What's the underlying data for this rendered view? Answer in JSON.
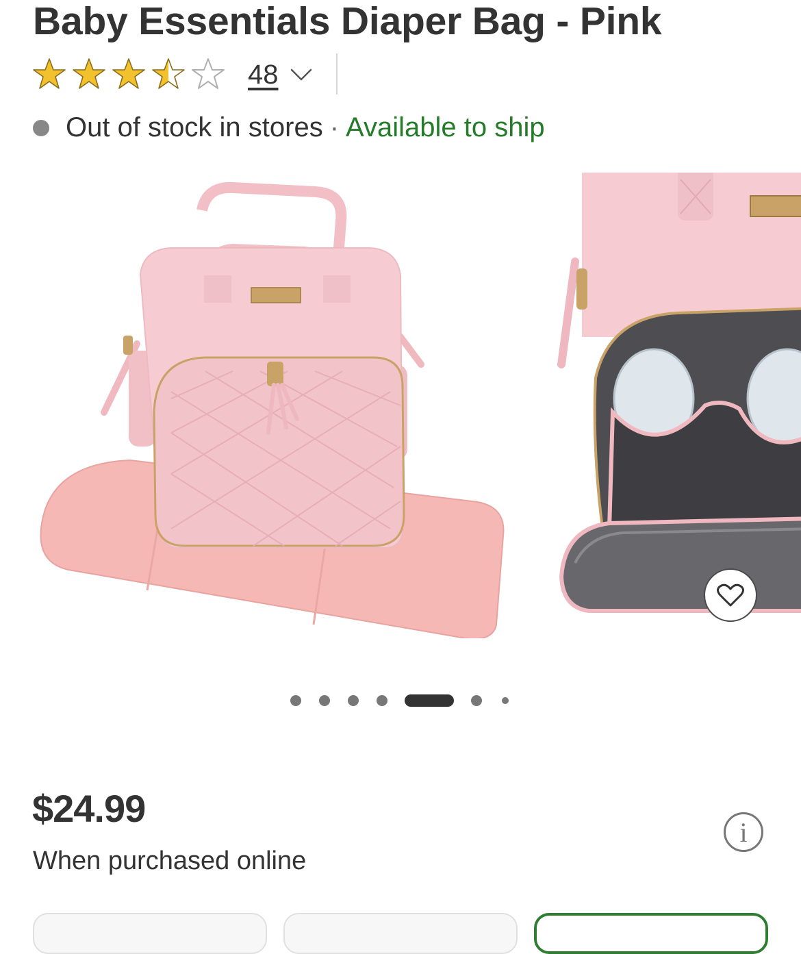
{
  "product": {
    "title": "Baby Essentials Diaper Bag - Pink",
    "rating": 3.5,
    "rating_max": 5,
    "review_count": "48"
  },
  "availability": {
    "in_store": "Out of stock in stores",
    "separator": "·",
    "ship": "Available to ship"
  },
  "gallery": {
    "slide_count": 7,
    "active_index": 4
  },
  "pricing": {
    "price": "$24.99",
    "note": "When purchased online",
    "info_label": "i"
  },
  "colors": {
    "text": "#333333",
    "available_green": "#247c2a",
    "star_gold": "#f2c12e",
    "star_outline": "#b0b0b0",
    "selected_border": "#2e7d32",
    "bag_pink": "#f2c6cc"
  }
}
